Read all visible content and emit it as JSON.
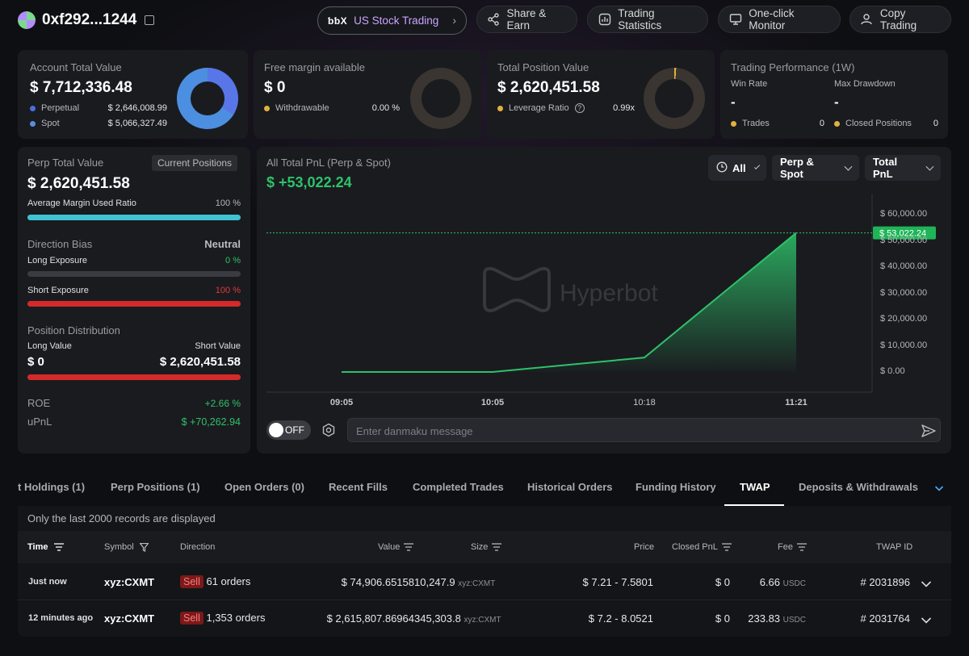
{
  "header": {
    "address": "0xf292...1244",
    "us_logo": "ƅƅX",
    "buttons": {
      "us_stock": "US Stock Trading",
      "share_earn": "Share & Earn",
      "trading_stats": "Trading Statistics",
      "monitor": "One-click Monitor",
      "copy_trading": "Copy Trading"
    }
  },
  "account": {
    "title": "Account Total Value",
    "value": "$ 7,712,336.48",
    "perp_label": "Perpetual",
    "perp_value": "$ 2,646,008.99",
    "spot_label": "Spot",
    "spot_value": "$ 5,066,327.49",
    "perp_color": "#4a6fe0",
    "spot_color": "#5a8fd8"
  },
  "free_margin": {
    "title": "Free margin available",
    "value": "$ 0",
    "withdrawable_label": "Withdrawable",
    "withdrawable_value": "0.00 %"
  },
  "position": {
    "title": "Total Position Value",
    "value": "$ 2,620,451.58",
    "leverage_label": "Leverage Ratio",
    "leverage_value": "0.99x"
  },
  "performance": {
    "title": "Trading Performance (1W)",
    "win_rate_label": "Win Rate",
    "win_rate_value": "-",
    "max_dd_label": "Max Drawdown",
    "max_dd_value": "-",
    "trades_label": "Trades",
    "trades_value": "0",
    "closed_label": "Closed Positions",
    "closed_value": "0"
  },
  "perp_panel": {
    "title": "Perp Total Value",
    "badge": "Current Positions",
    "value": "$ 2,620,451.58",
    "margin_label": "Average Margin Used Ratio",
    "margin_value": "100 %",
    "margin_ratio": 1.0,
    "bias_label": "Direction Bias",
    "bias_value": "Neutral",
    "long_label": "Long Exposure",
    "long_value": "0 %",
    "short_label": "Short Exposure",
    "short_value": "100 %",
    "dist_label": "Position Distribution",
    "long_value_label": "Long Value",
    "short_value_label": "Short Value",
    "long_amount": "$ 0",
    "short_amount": "$ 2,620,451.58",
    "roe_label": "ROE",
    "roe_value": "+2.66 %",
    "upnl_label": "uPnL",
    "upnl_value": "$ +70,262.94"
  },
  "pnl_chart": {
    "title": "All Total PnL (Perp & Spot)",
    "value": "$ +53,022.24",
    "filter_time": "All",
    "filter_scope": "Perp & Spot",
    "filter_metric": "Total PnL",
    "current_tag": "$ 53,022.24",
    "watermark": "Hyperbot",
    "toggle_label": "OFF",
    "danmaku_placeholder": "Enter danmaku message"
  },
  "chart_data": {
    "type": "area",
    "x": [
      "09:05",
      "10:05",
      "10:18",
      "11:21"
    ],
    "values": [
      0,
      0,
      5500,
      53022.24
    ],
    "y_ticks": [
      "$ 60,000.00",
      "$ 50,000.00",
      "$ 40,000.00",
      "$ 30,000.00",
      "$ 20,000.00",
      "$ 10,000.00",
      "$ 0.00"
    ],
    "ylim": [
      0,
      60000
    ],
    "line_color": "#2ec26a"
  },
  "tabs": [
    "t Holdings (1)",
    "Perp Positions (1)",
    "Open Orders (0)",
    "Recent Fills",
    "Completed Trades",
    "Historical Orders",
    "Funding History",
    "TWAP",
    "Deposits & Withdrawals"
  ],
  "table": {
    "notice": "Only the last 2000 records are displayed",
    "headers": {
      "time": "Time",
      "symbol": "Symbol",
      "direction": "Direction",
      "value": "Value",
      "size": "Size",
      "price": "Price",
      "closed_pnl": "Closed PnL",
      "fee": "Fee",
      "twap_id": "TWAP ID"
    },
    "rows": [
      {
        "time": "Just now",
        "symbol": "xyz:CXMT",
        "side": "Sell",
        "orders": "61 orders",
        "value": "$ 74,906.65158",
        "size": "10,247.9",
        "size_unit": "xyz:CXMT",
        "price": "$ 7.21 - 7.5801",
        "closed_pnl": "$ 0",
        "fee": "6.66",
        "fee_unit": "USDC",
        "twap_id": "# 2031896"
      },
      {
        "time": "12 minutes ago",
        "symbol": "xyz:CXMT",
        "side": "Sell",
        "orders": "1,353 orders",
        "value": "$ 2,615,807.86964",
        "size": "345,303.8",
        "size_unit": "xyz:CXMT",
        "price": "$ 7.2 - 8.0521",
        "closed_pnl": "$ 0",
        "fee": "233.83",
        "fee_unit": "USDC",
        "twap_id": "# 2031764"
      }
    ]
  }
}
